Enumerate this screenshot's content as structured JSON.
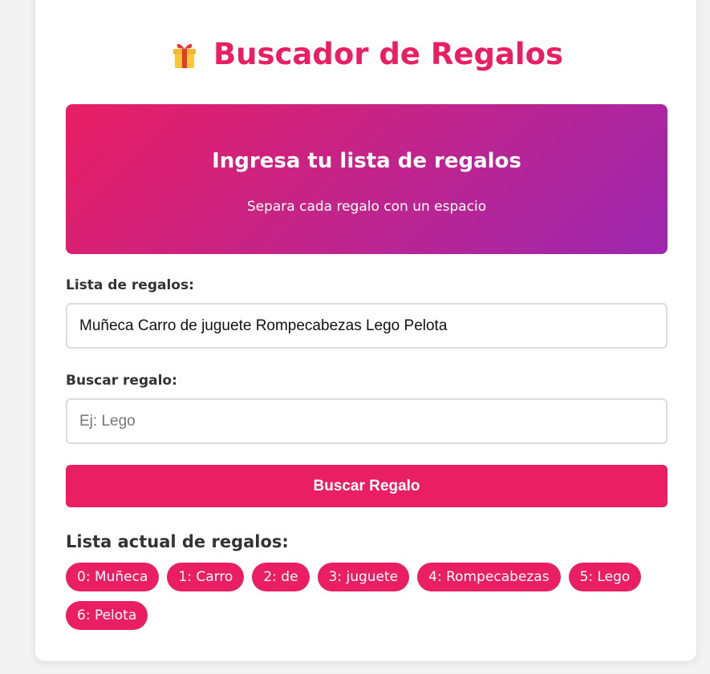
{
  "header": {
    "title": "Buscador de Regalos",
    "icon": "gift-icon"
  },
  "banner": {
    "title": "Ingresa tu lista de regalos",
    "subtitle": "Separa cada regalo con un espacio"
  },
  "form": {
    "list_label": "Lista de regalos:",
    "list_value": "Muñeca Carro de juguete Rompecabezas Lego Pelota",
    "search_label": "Buscar regalo:",
    "search_placeholder": "Ej: Lego",
    "search_value": "",
    "search_button_label": "Buscar Regalo"
  },
  "current_list": {
    "heading": "Lista actual de regalos:",
    "items": [
      {
        "label": "0: Muñeca"
      },
      {
        "label": "1: Carro"
      },
      {
        "label": "2: de"
      },
      {
        "label": "3: juguete"
      },
      {
        "label": "4: Rompecabezas"
      },
      {
        "label": "5: Lego"
      },
      {
        "label": "6: Pelota"
      }
    ]
  },
  "colors": {
    "accent": "#e91e63",
    "gradient_end": "#9c27b0",
    "background": "#f3f3f3"
  }
}
